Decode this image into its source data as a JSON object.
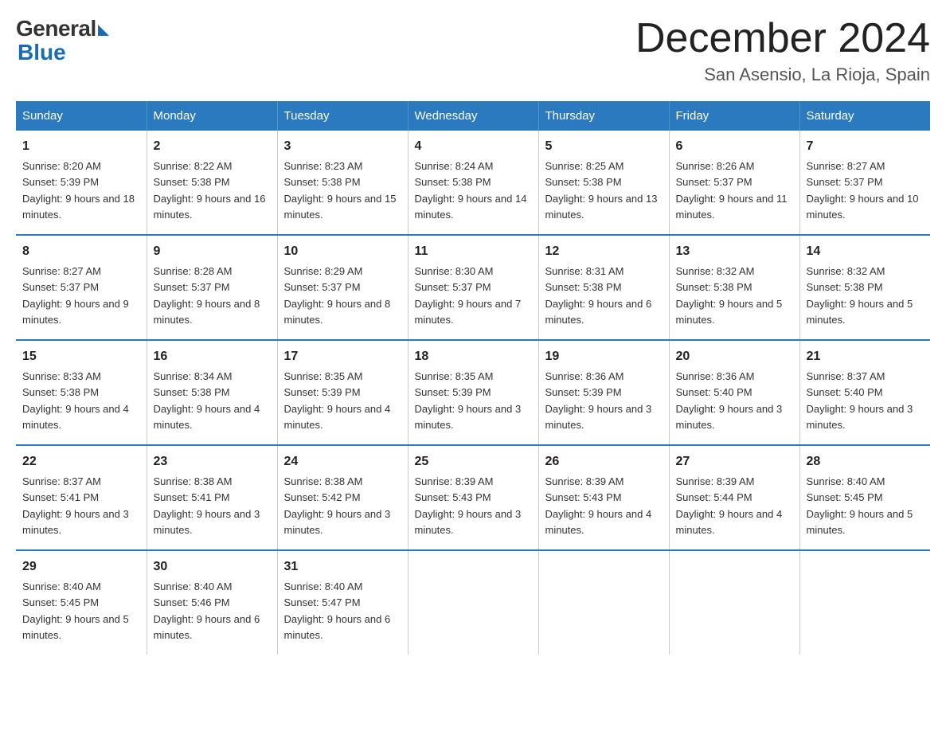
{
  "logo": {
    "general": "General",
    "blue": "Blue"
  },
  "title": "December 2024",
  "subtitle": "San Asensio, La Rioja, Spain",
  "headers": [
    "Sunday",
    "Monday",
    "Tuesday",
    "Wednesday",
    "Thursday",
    "Friday",
    "Saturday"
  ],
  "weeks": [
    [
      {
        "day": "1",
        "sunrise": "8:20 AM",
        "sunset": "5:39 PM",
        "daylight": "9 hours and 18 minutes."
      },
      {
        "day": "2",
        "sunrise": "8:22 AM",
        "sunset": "5:38 PM",
        "daylight": "9 hours and 16 minutes."
      },
      {
        "day": "3",
        "sunrise": "8:23 AM",
        "sunset": "5:38 PM",
        "daylight": "9 hours and 15 minutes."
      },
      {
        "day": "4",
        "sunrise": "8:24 AM",
        "sunset": "5:38 PM",
        "daylight": "9 hours and 14 minutes."
      },
      {
        "day": "5",
        "sunrise": "8:25 AM",
        "sunset": "5:38 PM",
        "daylight": "9 hours and 13 minutes."
      },
      {
        "day": "6",
        "sunrise": "8:26 AM",
        "sunset": "5:37 PM",
        "daylight": "9 hours and 11 minutes."
      },
      {
        "day": "7",
        "sunrise": "8:27 AM",
        "sunset": "5:37 PM",
        "daylight": "9 hours and 10 minutes."
      }
    ],
    [
      {
        "day": "8",
        "sunrise": "8:27 AM",
        "sunset": "5:37 PM",
        "daylight": "9 hours and 9 minutes."
      },
      {
        "day": "9",
        "sunrise": "8:28 AM",
        "sunset": "5:37 PM",
        "daylight": "9 hours and 8 minutes."
      },
      {
        "day": "10",
        "sunrise": "8:29 AM",
        "sunset": "5:37 PM",
        "daylight": "9 hours and 8 minutes."
      },
      {
        "day": "11",
        "sunrise": "8:30 AM",
        "sunset": "5:37 PM",
        "daylight": "9 hours and 7 minutes."
      },
      {
        "day": "12",
        "sunrise": "8:31 AM",
        "sunset": "5:38 PM",
        "daylight": "9 hours and 6 minutes."
      },
      {
        "day": "13",
        "sunrise": "8:32 AM",
        "sunset": "5:38 PM",
        "daylight": "9 hours and 5 minutes."
      },
      {
        "day": "14",
        "sunrise": "8:32 AM",
        "sunset": "5:38 PM",
        "daylight": "9 hours and 5 minutes."
      }
    ],
    [
      {
        "day": "15",
        "sunrise": "8:33 AM",
        "sunset": "5:38 PM",
        "daylight": "9 hours and 4 minutes."
      },
      {
        "day": "16",
        "sunrise": "8:34 AM",
        "sunset": "5:38 PM",
        "daylight": "9 hours and 4 minutes."
      },
      {
        "day": "17",
        "sunrise": "8:35 AM",
        "sunset": "5:39 PM",
        "daylight": "9 hours and 4 minutes."
      },
      {
        "day": "18",
        "sunrise": "8:35 AM",
        "sunset": "5:39 PM",
        "daylight": "9 hours and 3 minutes."
      },
      {
        "day": "19",
        "sunrise": "8:36 AM",
        "sunset": "5:39 PM",
        "daylight": "9 hours and 3 minutes."
      },
      {
        "day": "20",
        "sunrise": "8:36 AM",
        "sunset": "5:40 PM",
        "daylight": "9 hours and 3 minutes."
      },
      {
        "day": "21",
        "sunrise": "8:37 AM",
        "sunset": "5:40 PM",
        "daylight": "9 hours and 3 minutes."
      }
    ],
    [
      {
        "day": "22",
        "sunrise": "8:37 AM",
        "sunset": "5:41 PM",
        "daylight": "9 hours and 3 minutes."
      },
      {
        "day": "23",
        "sunrise": "8:38 AM",
        "sunset": "5:41 PM",
        "daylight": "9 hours and 3 minutes."
      },
      {
        "day": "24",
        "sunrise": "8:38 AM",
        "sunset": "5:42 PM",
        "daylight": "9 hours and 3 minutes."
      },
      {
        "day": "25",
        "sunrise": "8:39 AM",
        "sunset": "5:43 PM",
        "daylight": "9 hours and 3 minutes."
      },
      {
        "day": "26",
        "sunrise": "8:39 AM",
        "sunset": "5:43 PM",
        "daylight": "9 hours and 4 minutes."
      },
      {
        "day": "27",
        "sunrise": "8:39 AM",
        "sunset": "5:44 PM",
        "daylight": "9 hours and 4 minutes."
      },
      {
        "day": "28",
        "sunrise": "8:40 AM",
        "sunset": "5:45 PM",
        "daylight": "9 hours and 5 minutes."
      }
    ],
    [
      {
        "day": "29",
        "sunrise": "8:40 AM",
        "sunset": "5:45 PM",
        "daylight": "9 hours and 5 minutes."
      },
      {
        "day": "30",
        "sunrise": "8:40 AM",
        "sunset": "5:46 PM",
        "daylight": "9 hours and 6 minutes."
      },
      {
        "day": "31",
        "sunrise": "8:40 AM",
        "sunset": "5:47 PM",
        "daylight": "9 hours and 6 minutes."
      },
      null,
      null,
      null,
      null
    ]
  ]
}
